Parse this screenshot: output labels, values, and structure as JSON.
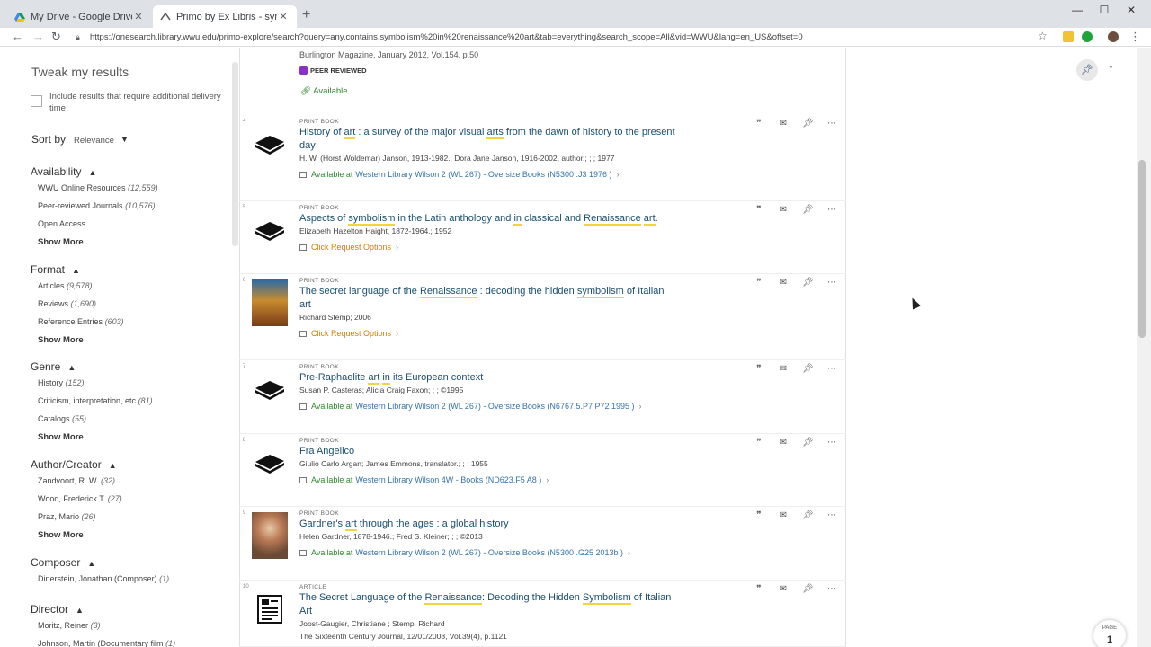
{
  "browser": {
    "tabs": [
      {
        "title": "My Drive - Google Drive",
        "active": false
      },
      {
        "title": "Primo by Ex Libris - symbolism in",
        "active": true
      }
    ],
    "url": "https://onesearch.library.wwu.edu/primo-explore/search?query=any,contains,symbolism%20in%20renaissance%20art&tab=everything&search_scope=All&vid=WWU&lang=en_US&offset=0"
  },
  "sidebar": {
    "title": "Tweak my results",
    "delivery_checkbox_label": "Include results that require additional delivery time",
    "sort_label": "Sort by",
    "sort_value": "Relevance",
    "show_more": "Show More",
    "facets": [
      {
        "heading": "Availability",
        "items": [
          {
            "label": "WWU Online Resources",
            "count": "(12,559)"
          },
          {
            "label": "Peer-reviewed Journals",
            "count": "(10,576)"
          },
          {
            "label": "Open Access",
            "count": ""
          }
        ]
      },
      {
        "heading": "Format",
        "items": [
          {
            "label": "Articles",
            "count": "(9,578)"
          },
          {
            "label": "Reviews",
            "count": "(1,690)"
          },
          {
            "label": "Reference Entries",
            "count": "(603)"
          }
        ]
      },
      {
        "heading": "Genre",
        "items": [
          {
            "label": "History",
            "count": "(152)"
          },
          {
            "label": "Criticism, interpretation, etc",
            "count": "(81)"
          },
          {
            "label": "Catalogs",
            "count": "(55)"
          }
        ]
      },
      {
        "heading": "Author/Creator",
        "items": [
          {
            "label": "Zandvoort, R. W.",
            "count": "(32)"
          },
          {
            "label": "Wood, Frederick T.",
            "count": "(27)"
          },
          {
            "label": "Praz, Mario",
            "count": "(26)"
          }
        ]
      },
      {
        "heading": "Composer",
        "items": [
          {
            "label": "Dinerstein, Jonathan (Composer)",
            "count": "(1)"
          }
        ]
      },
      {
        "heading": "Director",
        "items": [
          {
            "label": "Moritz, Reiner",
            "count": "(3)"
          },
          {
            "label": "Johnson, Martin (Documentary film",
            "count": "(1)"
          }
        ]
      }
    ]
  },
  "top_result": {
    "journal": "Burlington Magazine, January 2012, Vol.154, p.50",
    "peer_reviewed": "PEER REVIEWED",
    "availability": "Available"
  },
  "records": [
    {
      "num": "4",
      "type": "PRINT BOOK",
      "title_parts": [
        [
          "History of ",
          0
        ],
        [
          "art",
          1
        ],
        [
          " : a survey of the major visual ",
          0
        ],
        [
          "arts",
          1
        ],
        [
          " from the dawn of history to the present day",
          0
        ]
      ],
      "meta": "H. W. (Horst Woldemar) Janson, 1913-1982.; Dora Jane Janson, 1916-2002, author.; ; ; 1977",
      "meta2": "",
      "avail_status": "Available at",
      "avail_loc": "Western Library  Wilson 2 (WL 267) - Oversize Books (N5300 .J3 1976 )",
      "avail_kind": "ok"
    },
    {
      "num": "5",
      "type": "PRINT BOOK",
      "title_parts": [
        [
          "Aspects of ",
          0
        ],
        [
          "symbolism",
          1
        ],
        [
          " in the Latin anthology and ",
          0
        ],
        [
          "in",
          1
        ],
        [
          " classical and ",
          0
        ],
        [
          "Renaissance",
          1
        ],
        [
          " ",
          0
        ],
        [
          "art",
          1
        ],
        [
          ".",
          0
        ]
      ],
      "meta": "Elizabeth Hazelton Haight, 1872-1964.; 1952",
      "meta2": "",
      "avail_status": "Click Request Options",
      "avail_loc": "",
      "avail_kind": "req"
    },
    {
      "num": "6",
      "type": "PRINT BOOK",
      "title_parts": [
        [
          "The secret language of the ",
          0
        ],
        [
          "Renaissance",
          1
        ],
        [
          " : decoding the hidden ",
          0
        ],
        [
          "symbolism",
          1
        ],
        [
          " of Italian art",
          0
        ]
      ],
      "meta": "Richard Stemp; 2006",
      "meta2": "",
      "avail_status": "Click Request Options",
      "avail_loc": "",
      "avail_kind": "req"
    },
    {
      "num": "7",
      "type": "PRINT BOOK",
      "title_parts": [
        [
          "Pre-Raphaelite ",
          0
        ],
        [
          "art",
          1
        ],
        [
          " ",
          0
        ],
        [
          "in",
          1
        ],
        [
          " its European context",
          0
        ]
      ],
      "meta": "Susan P. Casteras; Alicia Craig Faxon; ; ; ©1995",
      "meta2": "",
      "avail_status": "Available at",
      "avail_loc": "Western Library  Wilson 2 (WL 267) - Oversize Books (N6767.5.P7 P72 1995 )",
      "avail_kind": "ok"
    },
    {
      "num": "8",
      "type": "PRINT BOOK",
      "title_parts": [
        [
          "Fra Angelico",
          0
        ]
      ],
      "meta": "Giulio Carlo Argan; James Emmons, translator.; ; ; 1955",
      "meta2": "",
      "avail_status": "Available at",
      "avail_loc": "Western Library  Wilson 4W - Books (ND623.F5 A8 )",
      "avail_kind": "ok"
    },
    {
      "num": "9",
      "type": "PRINT BOOK",
      "title_parts": [
        [
          "Gardner's ",
          0
        ],
        [
          "art",
          1
        ],
        [
          " through the ages : a global history",
          0
        ]
      ],
      "meta": "Helen Gardner, 1878-1946.; Fred S. Kleiner; ; ; ©2013",
      "meta2": "",
      "avail_status": "Available at",
      "avail_loc": "Western Library  Wilson 2 (WL 267) - Oversize Books (N5300 .G25 2013b )",
      "avail_kind": "ok"
    },
    {
      "num": "10",
      "type": "ARTICLE",
      "title_parts": [
        [
          "The Secret Language of the ",
          0
        ],
        [
          "Renaissance",
          1
        ],
        [
          ": Decoding the Hidden ",
          0
        ],
        [
          "Symbolism",
          1
        ],
        [
          " of Italian Art",
          0
        ]
      ],
      "meta": "Joost-Gaugier, Christiane ; Stemp, Richard",
      "meta2": "The Sixteenth Century Journal, 12/01/2008, Vol.39(4), p.1121",
      "avail_status": "",
      "avail_loc": "",
      "avail_kind": "none"
    }
  ],
  "page_badge": {
    "label": "PAGE",
    "number": "1"
  }
}
